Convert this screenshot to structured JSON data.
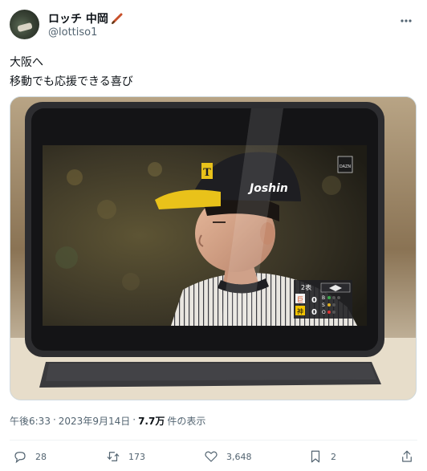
{
  "author": {
    "display_name": "ロッチ 中岡",
    "handle": "@lottiso1",
    "name_emoji_icon": "baseball-bat-icon"
  },
  "tweet": {
    "line1": "大阪へ",
    "line2": "移動でも応援できる喜び"
  },
  "media": {
    "overlay_brand": "Joshin",
    "network_logo": "DAZN",
    "scoreboard": {
      "inning": "2表",
      "team1": "巨",
      "score1": "0",
      "team2": "神",
      "score2": "0",
      "bso_labels": [
        "B",
        "S",
        "O"
      ]
    }
  },
  "meta": {
    "time": "午後6:33",
    "separator": "·",
    "date": "2023年9月14日",
    "views_count": "7.7万",
    "views_label": "件の表示"
  },
  "actions": {
    "replies": "28",
    "retweets": "173",
    "likes": "3,648",
    "bookmarks": "2"
  },
  "colors": {
    "text_primary": "#0f1419",
    "text_secondary": "#536471",
    "tigers_yellow": "#f2c300"
  }
}
